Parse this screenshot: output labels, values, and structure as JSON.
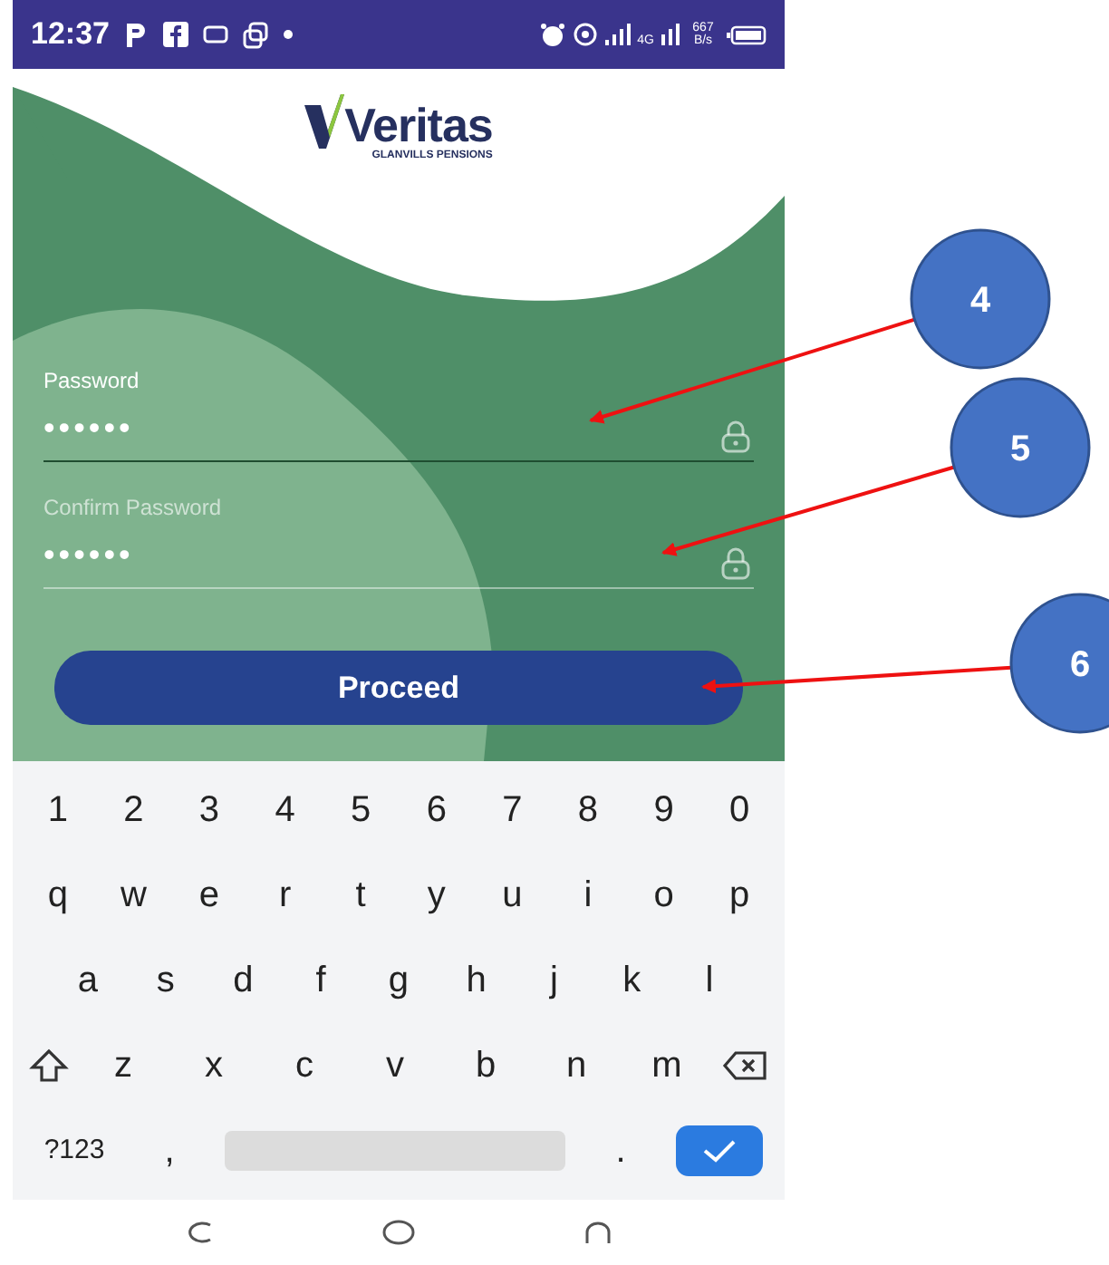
{
  "status_bar": {
    "time": "12:37",
    "network": "4G",
    "speed": "667 B/s"
  },
  "logo": {
    "name": "Veritas",
    "subtitle": "GLANVILLS PENSIONS"
  },
  "fields": [
    {
      "label": "Password",
      "value": "••••••",
      "focused": true
    },
    {
      "label": "Confirm Password",
      "value": "••••••",
      "focused": false
    }
  ],
  "proceed_button": "Proceed",
  "keyboard": {
    "number_keys": [
      "1",
      "2",
      "3",
      "4",
      "5",
      "6",
      "7",
      "8",
      "9",
      "0"
    ],
    "top_letter_keys": [
      "q",
      "w",
      "e",
      "r",
      "t",
      "y",
      "u",
      "i",
      "o",
      "p"
    ],
    "middle_letter_keys": [
      "a",
      "s",
      "d",
      "f",
      "g",
      "h",
      "j",
      "k",
      "l"
    ],
    "bottom_letter_keys": [
      "z",
      "x",
      "c",
      "v",
      "b",
      "n",
      "m"
    ],
    "symbols_key": "?123",
    "comma_key": ",",
    "period_key": "."
  },
  "annotations": [
    {
      "label": "4"
    },
    {
      "label": "5"
    },
    {
      "label": "6"
    }
  ]
}
